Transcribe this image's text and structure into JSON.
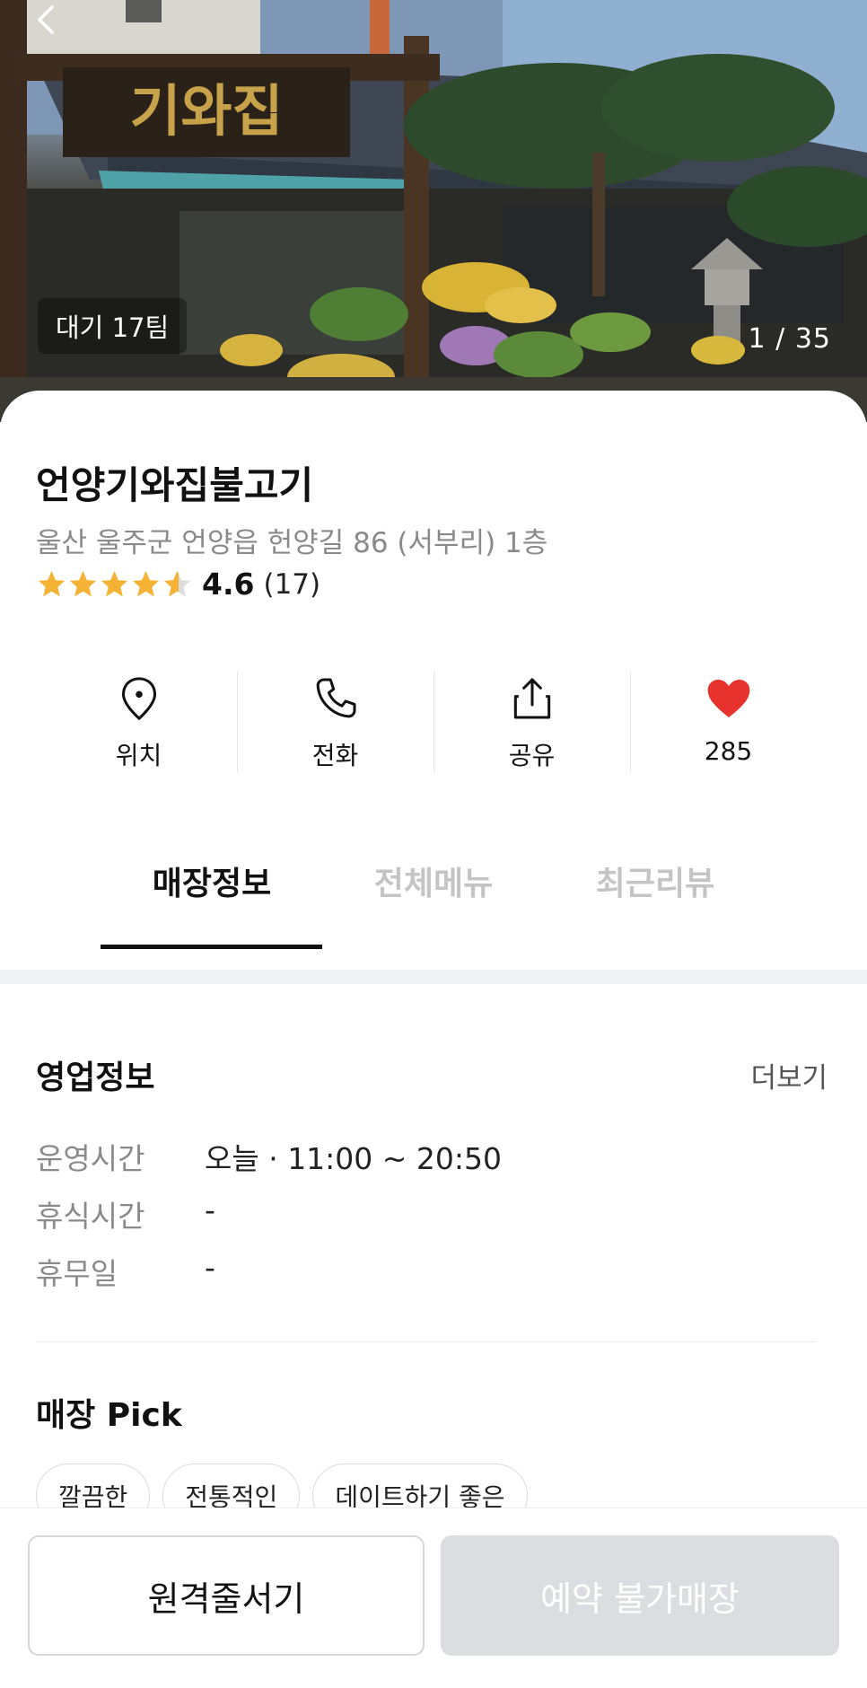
{
  "hero": {
    "signboard_text": "기와집",
    "wait_badge": "대기 17팀",
    "photo_counter": "1 / 35"
  },
  "store": {
    "name": "언양기와집불고기",
    "address": "울산 울주군 언양읍 헌양길 86 (서부리) 1층",
    "rating_value": 4.6,
    "rating_text": "4.6",
    "review_count": "(17)"
  },
  "actions": [
    {
      "label": "위치",
      "icon": "location-pin-icon"
    },
    {
      "label": "전화",
      "icon": "phone-icon"
    },
    {
      "label": "공유",
      "icon": "share-icon"
    },
    {
      "label": "285",
      "icon": "heart-icon"
    }
  ],
  "tabs": [
    {
      "label": "매장정보",
      "active": true
    },
    {
      "label": "전체메뉴",
      "active": false
    },
    {
      "label": "최근리뷰",
      "active": false
    }
  ],
  "business_info": {
    "title": "영업정보",
    "more": "더보기",
    "rows": [
      {
        "label": "운영시간",
        "value": "오늘 · 11:00 ~ 20:50"
      },
      {
        "label": "휴식시간",
        "value": "-"
      },
      {
        "label": "휴무일",
        "value": "-"
      }
    ]
  },
  "store_pick": {
    "title": "매장 Pick",
    "chips": [
      "깔끔한",
      "전통적인",
      "데이트하기 좋은"
    ]
  },
  "bottom": {
    "remote_queue": "원격줄서기",
    "reservation": "예약 불가매장"
  },
  "colors": {
    "star": "#f5b335",
    "heart": "#e8322e",
    "disabled_button": "#dcdde0"
  }
}
